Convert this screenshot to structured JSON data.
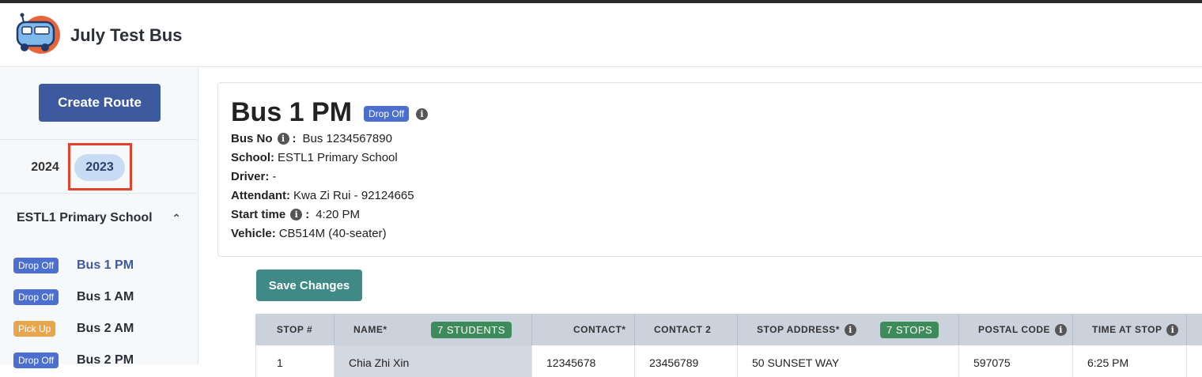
{
  "app": {
    "title": "July Test Bus",
    "logo": "bus-mascot-logo"
  },
  "sidebar": {
    "create_label": "Create Route",
    "years": [
      "2024",
      "2023"
    ],
    "selected_year": "2023",
    "school": "ESTL1 Primary School",
    "routes": [
      {
        "badge": "Drop Off",
        "name": "Bus 1 PM",
        "active": true
      },
      {
        "badge": "Drop Off",
        "name": "Bus 1 AM",
        "active": false
      },
      {
        "badge": "Pick Up",
        "name": "Bus 2 AM",
        "active": false
      },
      {
        "badge": "Drop Off",
        "name": "Bus 2 PM",
        "active": false
      }
    ]
  },
  "route": {
    "title": "Bus 1 PM",
    "type_badge": "Drop Off",
    "bus_no_label": "Bus No",
    "bus_no": "Bus 1234567890",
    "school_label": "School:",
    "school": "ESTL1 Primary School",
    "driver_label": "Driver:",
    "driver": "-",
    "attendant_label": "Attendant:",
    "attendant": "Kwa Zi Rui - 92124665",
    "start_label": "Start time",
    "start": "4:20 PM",
    "vehicle_label": "Vehicle:",
    "vehicle": "CB514M (40-seater)"
  },
  "actions": {
    "save_label": "Save Changes"
  },
  "table": {
    "headers": {
      "stop": "STOP #",
      "name": "NAME*",
      "students": "7 STUDENTS",
      "contact": "CONTACT*",
      "contact2": "CONTACT 2",
      "address": "STOP ADDRESS*",
      "stops": "7 STOPS",
      "postal": "POSTAL CODE",
      "time": "TIME AT STOP"
    },
    "rows": [
      {
        "stop": "1",
        "name": "Chia Zhi Xin",
        "contact": "12345678",
        "contact2": "23456789",
        "address": "50 SUNSET WAY",
        "postal": "597075",
        "time": "6:25 PM"
      }
    ]
  },
  "colors": {
    "primary": "#3d5a9f",
    "save": "#3f8a86",
    "count_badge": "#3d8b5a",
    "drop_off": "#4a6fcf",
    "pick_up": "#e6a64c",
    "highlight": "#e0442c"
  }
}
